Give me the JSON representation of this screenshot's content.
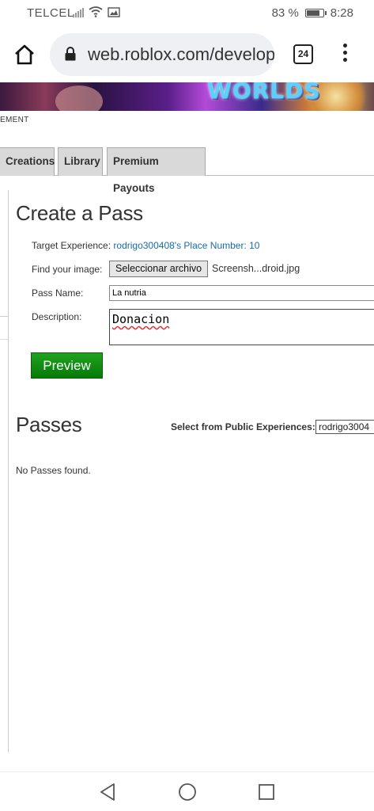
{
  "status_bar": {
    "carrier": "TELCEL",
    "battery_percent": "83 %",
    "battery_level": 0.83,
    "time": "8:28"
  },
  "browser": {
    "url": "web.roblox.com/develop",
    "tab_count": "24"
  },
  "banner": {
    "logo_text": "WORLDS"
  },
  "breadcrumb": "EMENT",
  "tabs": [
    {
      "label": "Creations"
    },
    {
      "label": "Library"
    },
    {
      "label": "Premium Payouts"
    }
  ],
  "create_pass": {
    "title": "Create a Pass",
    "target_label": "Target Experience:",
    "target_value": "rodrigo300408's Place Number: 10",
    "image_label": "Find your image:",
    "file_button": "Seleccionar archivo",
    "file_name": "Screensh...droid.jpg",
    "name_label": "Pass Name:",
    "name_value": "La nutria",
    "description_label": "Description:",
    "description_value": "Donacion",
    "preview_button": "Preview"
  },
  "passes": {
    "title": "Passes",
    "select_label": "Select from Public Experiences:",
    "select_value": "rodrigo3004",
    "empty_text": "No Passes found."
  }
}
